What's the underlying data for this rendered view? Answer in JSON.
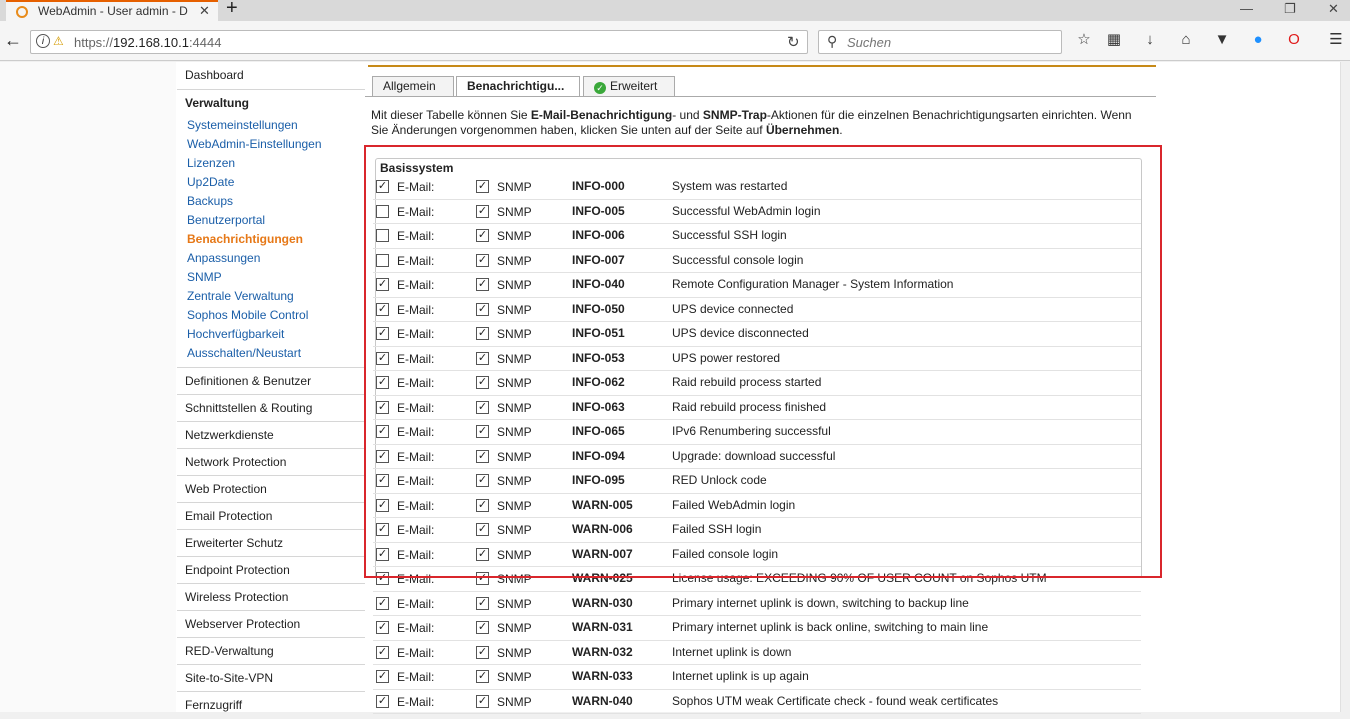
{
  "browser": {
    "tab_title": "WebAdmin - User admin - D",
    "url_prefix": "https://",
    "url_host": "192.168.10.1",
    "url_port": ":4444",
    "search_placeholder": "Suchen",
    "new_tab_glyph": "+",
    "close_glyph": "✕"
  },
  "sidebar": {
    "dashboard": "Dashboard",
    "verwaltung": "Verwaltung",
    "verwaltung_items": [
      "Systemeinstellungen",
      "WebAdmin-Einstellungen",
      "Lizenzen",
      "Up2Date",
      "Backups",
      "Benutzerportal",
      "Benachrichtigungen",
      "Anpassungen",
      "SNMP",
      "Zentrale Verwaltung",
      "Sophos Mobile Control",
      "Hochverfügbarkeit",
      "Ausschalten/Neustart"
    ],
    "active_item": "Benachrichtigungen",
    "sections": [
      "Definitionen & Benutzer",
      "Schnittstellen & Routing",
      "Netzwerkdienste",
      "Network Protection",
      "Web Protection",
      "Email Protection",
      "Erweiterter Schutz",
      "Endpoint Protection",
      "Wireless Protection",
      "Webserver Protection",
      "RED-Verwaltung",
      "Site-to-Site-VPN",
      "Fernzugriff"
    ]
  },
  "tabs": {
    "allgemein": "Allgemein",
    "benachrichtigungen": "Benachrichtigu...",
    "erweitert": "Erweitert"
  },
  "description": {
    "p1": "Mit dieser Tabelle können Sie ",
    "b1": "E-Mail-Benachrichtigung",
    "p2": "- und ",
    "b2": "SNMP-Trap",
    "p3": "-Aktionen für die einzelnen Benachrichtigungsarten einrichten. Wenn Sie Änderungen vorgenommen haben, klicken Sie unten auf der Seite auf ",
    "b3": "Übernehmen",
    "p4": "."
  },
  "table": {
    "section_title": "Basissystem",
    "email_label": "E-Mail:",
    "snmp_label": "SNMP",
    "rows": [
      {
        "email": true,
        "snmp": true,
        "code": "INFO-000",
        "desc": "System was restarted"
      },
      {
        "email": false,
        "snmp": true,
        "code": "INFO-005",
        "desc": "Successful WebAdmin login"
      },
      {
        "email": false,
        "snmp": true,
        "code": "INFO-006",
        "desc": "Successful SSH login"
      },
      {
        "email": false,
        "snmp": true,
        "code": "INFO-007",
        "desc": "Successful console login"
      },
      {
        "email": true,
        "snmp": true,
        "code": "INFO-040",
        "desc": "Remote Configuration Manager - System Information"
      },
      {
        "email": true,
        "snmp": true,
        "code": "INFO-050",
        "desc": "UPS device connected"
      },
      {
        "email": true,
        "snmp": true,
        "code": "INFO-051",
        "desc": "UPS device disconnected"
      },
      {
        "email": true,
        "snmp": true,
        "code": "INFO-053",
        "desc": "UPS power restored"
      },
      {
        "email": true,
        "snmp": true,
        "code": "INFO-062",
        "desc": "Raid rebuild process started"
      },
      {
        "email": true,
        "snmp": true,
        "code": "INFO-063",
        "desc": "Raid rebuild process finished"
      },
      {
        "email": true,
        "snmp": true,
        "code": "INFO-065",
        "desc": "IPv6 Renumbering successful"
      },
      {
        "email": true,
        "snmp": true,
        "code": "INFO-094",
        "desc": "Upgrade: download successful"
      },
      {
        "email": true,
        "snmp": true,
        "code": "INFO-095",
        "desc": "RED Unlock code"
      },
      {
        "email": true,
        "snmp": true,
        "code": "WARN-005",
        "desc": "Failed WebAdmin login"
      },
      {
        "email": true,
        "snmp": true,
        "code": "WARN-006",
        "desc": "Failed SSH login"
      },
      {
        "email": true,
        "snmp": true,
        "code": "WARN-007",
        "desc": "Failed console login"
      },
      {
        "email": true,
        "snmp": true,
        "code": "WARN-025",
        "desc": "License usage: EXCEEDING 90% OF USER COUNT on Sophos UTM"
      },
      {
        "email": true,
        "snmp": true,
        "code": "WARN-030",
        "desc": "Primary internet uplink is down, switching to backup line"
      },
      {
        "email": true,
        "snmp": true,
        "code": "WARN-031",
        "desc": "Primary internet uplink is back online, switching to main line"
      },
      {
        "email": true,
        "snmp": true,
        "code": "WARN-032",
        "desc": "Internet uplink is down"
      },
      {
        "email": true,
        "snmp": true,
        "code": "WARN-033",
        "desc": "Internet uplink is up again"
      },
      {
        "email": true,
        "snmp": true,
        "code": "WARN-040",
        "desc": "Sophos UTM weak Certificate check - found weak certificates"
      }
    ]
  },
  "colors": {
    "highlight": "#d9262c",
    "active_nav": "#e67817",
    "link": "#1a5ea8",
    "accent": "#c78a18"
  }
}
